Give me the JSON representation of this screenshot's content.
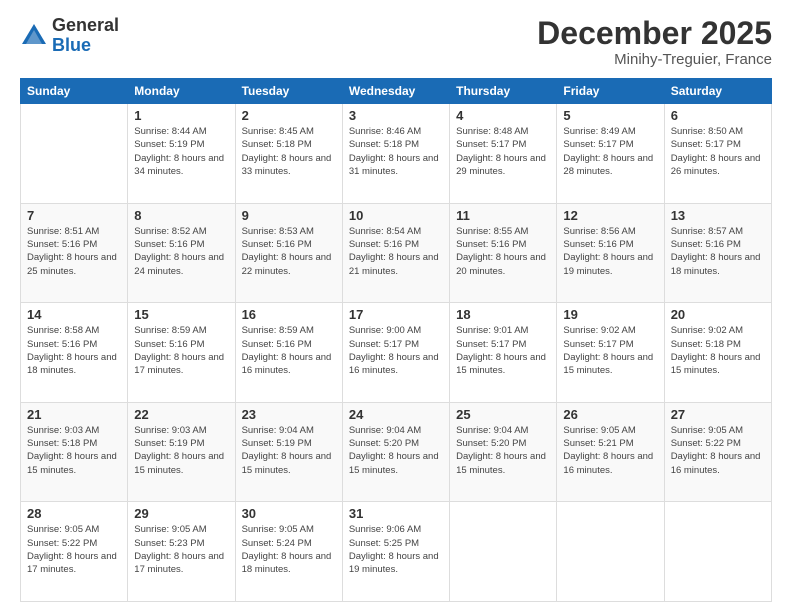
{
  "logo": {
    "general": "General",
    "blue": "Blue"
  },
  "title": {
    "month": "December 2025",
    "location": "Minihy-Treguier, France"
  },
  "headers": [
    "Sunday",
    "Monday",
    "Tuesday",
    "Wednesday",
    "Thursday",
    "Friday",
    "Saturday"
  ],
  "weeks": [
    [
      {
        "day": "",
        "sunrise": "",
        "sunset": "",
        "daylight": ""
      },
      {
        "day": "1",
        "sunrise": "Sunrise: 8:44 AM",
        "sunset": "Sunset: 5:19 PM",
        "daylight": "Daylight: 8 hours and 34 minutes."
      },
      {
        "day": "2",
        "sunrise": "Sunrise: 8:45 AM",
        "sunset": "Sunset: 5:18 PM",
        "daylight": "Daylight: 8 hours and 33 minutes."
      },
      {
        "day": "3",
        "sunrise": "Sunrise: 8:46 AM",
        "sunset": "Sunset: 5:18 PM",
        "daylight": "Daylight: 8 hours and 31 minutes."
      },
      {
        "day": "4",
        "sunrise": "Sunrise: 8:48 AM",
        "sunset": "Sunset: 5:17 PM",
        "daylight": "Daylight: 8 hours and 29 minutes."
      },
      {
        "day": "5",
        "sunrise": "Sunrise: 8:49 AM",
        "sunset": "Sunset: 5:17 PM",
        "daylight": "Daylight: 8 hours and 28 minutes."
      },
      {
        "day": "6",
        "sunrise": "Sunrise: 8:50 AM",
        "sunset": "Sunset: 5:17 PM",
        "daylight": "Daylight: 8 hours and 26 minutes."
      }
    ],
    [
      {
        "day": "7",
        "sunrise": "Sunrise: 8:51 AM",
        "sunset": "Sunset: 5:16 PM",
        "daylight": "Daylight: 8 hours and 25 minutes."
      },
      {
        "day": "8",
        "sunrise": "Sunrise: 8:52 AM",
        "sunset": "Sunset: 5:16 PM",
        "daylight": "Daylight: 8 hours and 24 minutes."
      },
      {
        "day": "9",
        "sunrise": "Sunrise: 8:53 AM",
        "sunset": "Sunset: 5:16 PM",
        "daylight": "Daylight: 8 hours and 22 minutes."
      },
      {
        "day": "10",
        "sunrise": "Sunrise: 8:54 AM",
        "sunset": "Sunset: 5:16 PM",
        "daylight": "Daylight: 8 hours and 21 minutes."
      },
      {
        "day": "11",
        "sunrise": "Sunrise: 8:55 AM",
        "sunset": "Sunset: 5:16 PM",
        "daylight": "Daylight: 8 hours and 20 minutes."
      },
      {
        "day": "12",
        "sunrise": "Sunrise: 8:56 AM",
        "sunset": "Sunset: 5:16 PM",
        "daylight": "Daylight: 8 hours and 19 minutes."
      },
      {
        "day": "13",
        "sunrise": "Sunrise: 8:57 AM",
        "sunset": "Sunset: 5:16 PM",
        "daylight": "Daylight: 8 hours and 18 minutes."
      }
    ],
    [
      {
        "day": "14",
        "sunrise": "Sunrise: 8:58 AM",
        "sunset": "Sunset: 5:16 PM",
        "daylight": "Daylight: 8 hours and 18 minutes."
      },
      {
        "day": "15",
        "sunrise": "Sunrise: 8:59 AM",
        "sunset": "Sunset: 5:16 PM",
        "daylight": "Daylight: 8 hours and 17 minutes."
      },
      {
        "day": "16",
        "sunrise": "Sunrise: 8:59 AM",
        "sunset": "Sunset: 5:16 PM",
        "daylight": "Daylight: 8 hours and 16 minutes."
      },
      {
        "day": "17",
        "sunrise": "Sunrise: 9:00 AM",
        "sunset": "Sunset: 5:17 PM",
        "daylight": "Daylight: 8 hours and 16 minutes."
      },
      {
        "day": "18",
        "sunrise": "Sunrise: 9:01 AM",
        "sunset": "Sunset: 5:17 PM",
        "daylight": "Daylight: 8 hours and 15 minutes."
      },
      {
        "day": "19",
        "sunrise": "Sunrise: 9:02 AM",
        "sunset": "Sunset: 5:17 PM",
        "daylight": "Daylight: 8 hours and 15 minutes."
      },
      {
        "day": "20",
        "sunrise": "Sunrise: 9:02 AM",
        "sunset": "Sunset: 5:18 PM",
        "daylight": "Daylight: 8 hours and 15 minutes."
      }
    ],
    [
      {
        "day": "21",
        "sunrise": "Sunrise: 9:03 AM",
        "sunset": "Sunset: 5:18 PM",
        "daylight": "Daylight: 8 hours and 15 minutes."
      },
      {
        "day": "22",
        "sunrise": "Sunrise: 9:03 AM",
        "sunset": "Sunset: 5:19 PM",
        "daylight": "Daylight: 8 hours and 15 minutes."
      },
      {
        "day": "23",
        "sunrise": "Sunrise: 9:04 AM",
        "sunset": "Sunset: 5:19 PM",
        "daylight": "Daylight: 8 hours and 15 minutes."
      },
      {
        "day": "24",
        "sunrise": "Sunrise: 9:04 AM",
        "sunset": "Sunset: 5:20 PM",
        "daylight": "Daylight: 8 hours and 15 minutes."
      },
      {
        "day": "25",
        "sunrise": "Sunrise: 9:04 AM",
        "sunset": "Sunset: 5:20 PM",
        "daylight": "Daylight: 8 hours and 15 minutes."
      },
      {
        "day": "26",
        "sunrise": "Sunrise: 9:05 AM",
        "sunset": "Sunset: 5:21 PM",
        "daylight": "Daylight: 8 hours and 16 minutes."
      },
      {
        "day": "27",
        "sunrise": "Sunrise: 9:05 AM",
        "sunset": "Sunset: 5:22 PM",
        "daylight": "Daylight: 8 hours and 16 minutes."
      }
    ],
    [
      {
        "day": "28",
        "sunrise": "Sunrise: 9:05 AM",
        "sunset": "Sunset: 5:22 PM",
        "daylight": "Daylight: 8 hours and 17 minutes."
      },
      {
        "day": "29",
        "sunrise": "Sunrise: 9:05 AM",
        "sunset": "Sunset: 5:23 PM",
        "daylight": "Daylight: 8 hours and 17 minutes."
      },
      {
        "day": "30",
        "sunrise": "Sunrise: 9:05 AM",
        "sunset": "Sunset: 5:24 PM",
        "daylight": "Daylight: 8 hours and 18 minutes."
      },
      {
        "day": "31",
        "sunrise": "Sunrise: 9:06 AM",
        "sunset": "Sunset: 5:25 PM",
        "daylight": "Daylight: 8 hours and 19 minutes."
      },
      {
        "day": "",
        "sunrise": "",
        "sunset": "",
        "daylight": ""
      },
      {
        "day": "",
        "sunrise": "",
        "sunset": "",
        "daylight": ""
      },
      {
        "day": "",
        "sunrise": "",
        "sunset": "",
        "daylight": ""
      }
    ]
  ]
}
